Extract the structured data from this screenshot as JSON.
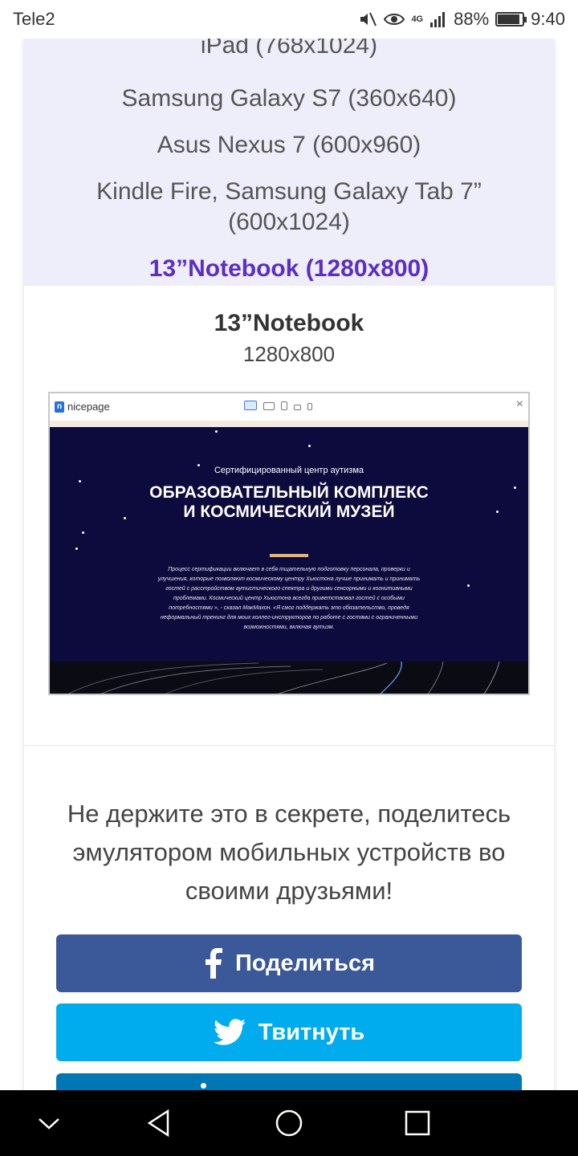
{
  "status_bar": {
    "carrier": "Tele2",
    "network": "4G",
    "battery_percent_label": "88%",
    "battery_level": 0.88,
    "time": "9:40"
  },
  "devices": {
    "items": [
      "iPad  (768x1024)",
      "Samsung Galaxy S7  (360x640)",
      "Asus Nexus 7  (600x960)",
      "Kindle Fire, Samsung Galaxy Tab 7”",
      "(600x1024)"
    ],
    "active": "13”Notebook  (1280x800)"
  },
  "preview": {
    "title": "13”Notebook",
    "size": "1280x800",
    "brand": "nicepage",
    "brand_letter": "n",
    "close_glyph": "×",
    "site": {
      "subtitle": "Сертифицированный центр аутизма",
      "headline": "ОБРАЗОВАТЕЛЬНЫЙ КОМПЛЕКС И КОСМИЧЕСКИЙ МУЗЕЙ",
      "paragraph": "Процесс сертификации включает в себя тщательную подготовку персонала, проверки и улучшения, которые позволяют космическому центру Хьюстона лучше принимать и принимать гостей с расстройством аутистического спектра и другими сенсорными и когнитивными проблемами. Космический центр Хьюстона всегда приветствовал гостей с особыми потребностями », - сказал МакМахон. «Я смог поддержать это обязательство, проведя неформальный тренинг для моих коллег-инструкторов по работе с гостями с ограниченными возможностями, включая аутизм.",
      "bg_color": "#0d0a3d",
      "accent_color": "#e6b46f"
    }
  },
  "share": {
    "text": "Не держите это в секрете, поделитесь эмулятором мобильных устройств во своими друзьями!",
    "facebook_label": "Поделиться",
    "twitter_label": "Твитнуть",
    "facebook_color": "#3b5998",
    "twitter_color": "#00acee",
    "linkedin_color": "#0077b5"
  },
  "colors": {
    "device_list_bg": "#eeedfa",
    "active_device": "#5a2fc2"
  }
}
